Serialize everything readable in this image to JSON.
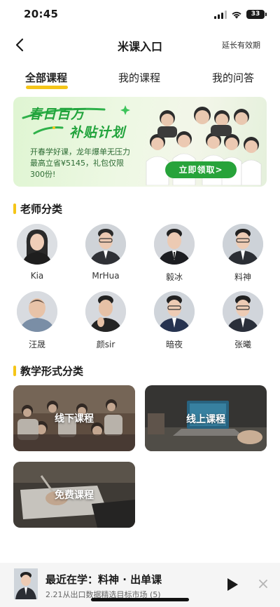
{
  "status_bar": {
    "time": "20:45",
    "battery": "33"
  },
  "nav": {
    "title": "米课入口",
    "action": "延长有效期"
  },
  "tabs": [
    {
      "label": "全部课程",
      "active": true
    },
    {
      "label": "我的课程",
      "active": false
    },
    {
      "label": "我的问答",
      "active": false
    }
  ],
  "banner": {
    "headline_1": "春日百万",
    "headline_2": "补贴计划",
    "line_1": "开春学好课，龙年爆单无压力",
    "line_2": "最高立省¥5145，礼包仅限",
    "line_3": "300份!",
    "cta": "立即领取>"
  },
  "teachers_section": {
    "title": "老师分类",
    "teachers": [
      {
        "name": "Kia"
      },
      {
        "name": "MrHua"
      },
      {
        "name": "毅冰"
      },
      {
        "name": "料神"
      },
      {
        "name": "汪晟"
      },
      {
        "name": "颜sir"
      },
      {
        "name": "暗夜"
      },
      {
        "name": "张曦"
      }
    ]
  },
  "formats_section": {
    "title": "教学形式分类",
    "cards": [
      {
        "label": "线下课程"
      },
      {
        "label": "线上课程"
      },
      {
        "label": "免费课程"
      }
    ]
  },
  "player": {
    "title": "最近在学：料神 · 出单课",
    "subtitle": "2.21从出口数据精选目标市场 (5)"
  },
  "colors": {
    "accent": "#f5c518",
    "banner_green": "#27a33a"
  },
  "icons": [
    "back-icon",
    "signal-icon",
    "wifi-icon",
    "battery-icon",
    "play-icon",
    "close-icon"
  ]
}
